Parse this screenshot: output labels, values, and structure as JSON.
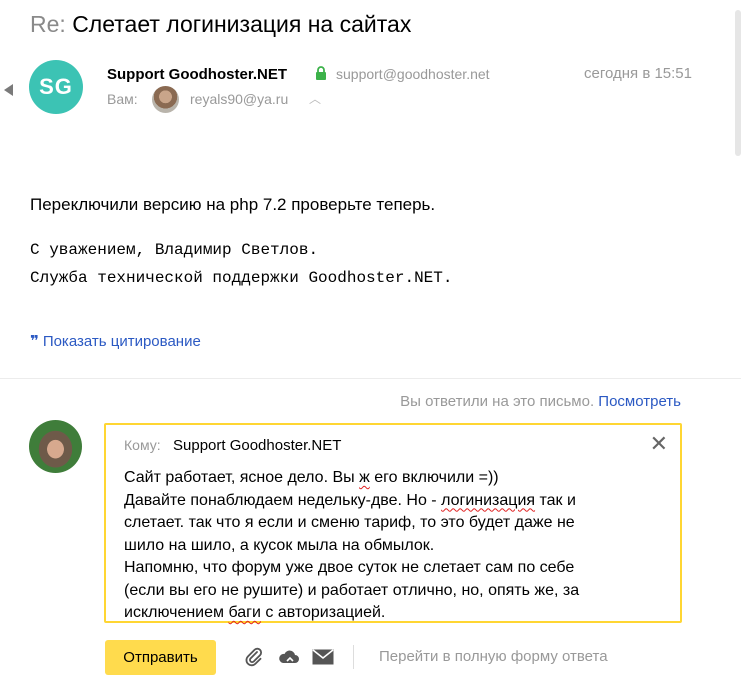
{
  "subject": {
    "prefix": "Re:",
    "title": "Слетает логинизация на сайтах"
  },
  "message": {
    "avatar_initials": "SG",
    "sender_name": "Support Goodhoster.NET",
    "sender_email": "support@goodhoster.net",
    "date": "сегодня в 15:51",
    "to_label": "Вам:",
    "to_email": "reyals90@ya.ru",
    "body": "Переключили версию на php 7.2 проверьте теперь.",
    "signature_line1": "С уважением, Владимир Светлов.",
    "signature_line2": "Служба технической поддержки Goodhoster.NET.",
    "show_quote": "Показать цитирование"
  },
  "reply_notice": {
    "text": "Вы ответили на это письмо.",
    "link": "Посмотреть"
  },
  "compose": {
    "to_prefix": "Кому:",
    "to_name": "Support Goodhoster.NET",
    "line1_a": "Сайт работает, ясное дело. Вы ",
    "line1_err": "ж",
    "line1_b": " его включили =))",
    "line2_a": "Давайте понаблюдаем недельку-две. Но - ",
    "line2_err": "логинизация",
    "line2_b": " так и",
    "line3": "слетает. так что я если и сменю тариф, то это будет даже не",
    "line4": "шило на шило, а кусок мыла на обмылок.",
    "line5": "Напомню, что форум уже двое суток не слетает сам по себе",
    "line6": "(если вы его не рушите) и работает отлично, но, опять же, за",
    "line7_a": "исключением ",
    "line7_err": "баги",
    "line7_b": " с авторизацией."
  },
  "toolbar": {
    "send_label": "Отправить",
    "full_form_label": "Перейти в полную форму ответа"
  },
  "colors": {
    "accent_yellow": "#ffdb4d",
    "link_blue": "#2b59c3",
    "avatar_teal": "#3cc3b4",
    "muted": "#999999"
  },
  "icons": [
    "lock-icon",
    "chevron-up-icon",
    "quote-icon",
    "close-icon",
    "paperclip-icon",
    "cloud-icon",
    "envelope-icon"
  ]
}
